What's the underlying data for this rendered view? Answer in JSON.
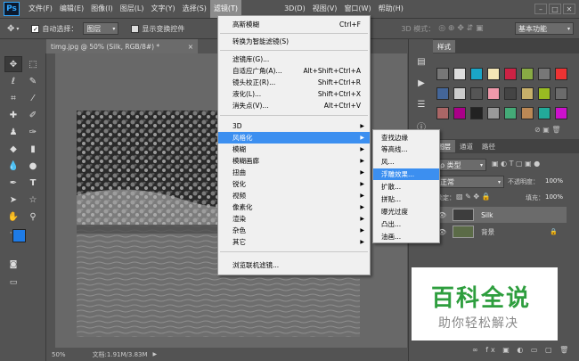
{
  "app": {
    "logo": "Ps"
  },
  "menubar": {
    "items": [
      "文件(F)",
      "编辑(E)",
      "图像(I)",
      "图层(L)",
      "文字(Y)",
      "选择(S)",
      "滤镜(T)",
      "3D(D)",
      "视图(V)",
      "窗口(W)",
      "帮助(H)"
    ],
    "window_buttons": [
      "–",
      "□",
      "✕"
    ]
  },
  "options": {
    "auto_select_label": "自动选择：",
    "auto_select_value": "图层",
    "transform_label": "显示变换控件",
    "mode_3d_label": "3D 模式：",
    "workspace": "基本功能"
  },
  "document": {
    "tab_title": "timg.jpg @ 50% (Silk, RGB/8#) *",
    "zoom": "50%",
    "doc_info": "文档:1.91M/3.83M"
  },
  "filter_menu": {
    "top": [
      {
        "label": "高斯模糊",
        "shortcut": "Ctrl+F"
      }
    ],
    "group1": [
      {
        "label": "转换为智能滤镜(S)"
      }
    ],
    "group2": [
      {
        "label": "滤镜库(G)..."
      },
      {
        "label": "自适应广角(A)...",
        "shortcut": "Alt+Shift+Ctrl+A"
      },
      {
        "label": "镜头校正(R)...",
        "shortcut": "Shift+Ctrl+R"
      },
      {
        "label": "液化(L)...",
        "shortcut": "Shift+Ctrl+X"
      },
      {
        "label": "消失点(V)...",
        "shortcut": "Alt+Ctrl+V"
      }
    ],
    "group3": [
      "3D",
      "风格化",
      "模糊",
      "模糊画廊",
      "扭曲",
      "锐化",
      "视频",
      "像素化",
      "渲染",
      "杂色",
      "其它"
    ],
    "highlighted": "风格化",
    "browse": "浏览联机滤镜..."
  },
  "stylize_submenu": {
    "items": [
      "查找边缘",
      "等高线...",
      "风...",
      "浮雕效果...",
      "扩散...",
      "拼贴...",
      "曝光过度",
      "凸出...",
      "油画..."
    ],
    "highlighted": "浮雕效果..."
  },
  "styles_panel": {
    "tab": "样式"
  },
  "layers_panel": {
    "tabs": [
      "图层",
      "通道",
      "路径"
    ],
    "filter_kind": "ρ 类型",
    "blend_mode": "正常",
    "opacity_label": "不透明度：",
    "opacity_value": "100%",
    "lock_label": "锁定：",
    "fill_label": "填充：",
    "fill_value": "100%",
    "layers": [
      {
        "name": "Silk",
        "selected": true
      },
      {
        "name": "背景",
        "locked": true
      }
    ]
  },
  "watermark": {
    "title": "百科全说",
    "subtitle": "助你轻松解决"
  },
  "colors": {
    "foreground": "#1e7be6",
    "background": "#ffffff",
    "highlight": "#3c8ff0"
  }
}
